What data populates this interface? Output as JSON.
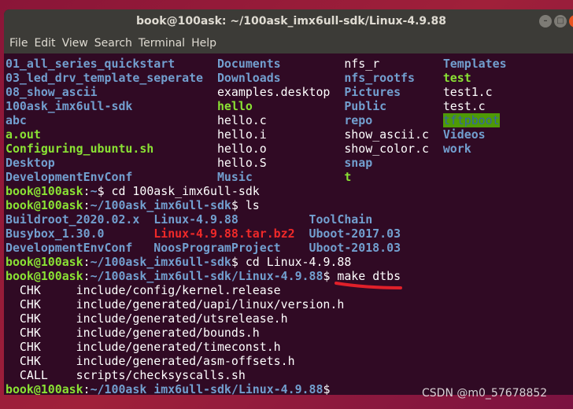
{
  "window": {
    "title": "book@100ask: ~/100ask_imx6ull-sdk/Linux-4.9.88"
  },
  "menu": [
    "File",
    "Edit",
    "View",
    "Search",
    "Terminal",
    "Help"
  ],
  "watermark": "CSDN @m0_57678852",
  "colors": {
    "background": "#300a24",
    "directory": "#729fcf",
    "executable": "#8ae234",
    "archive": "#ef2929",
    "annotation": "#e0202a"
  },
  "lines": [
    [
      {
        "t": "01_all_series_quickstart      ",
        "c": "dir"
      },
      {
        "t": "Documents         ",
        "c": "dir"
      },
      {
        "t": "nfs_r         ",
        "c": "plain"
      },
      {
        "t": "Templates",
        "c": "dir"
      }
    ],
    [
      {
        "t": "03_led_drv_template_seperate  ",
        "c": "dir"
      },
      {
        "t": "Downloads         ",
        "c": "dir"
      },
      {
        "t": "nfs_rootfs    ",
        "c": "dir"
      },
      {
        "t": "test",
        "c": "exe"
      }
    ],
    [
      {
        "t": "08_show_ascii                 ",
        "c": "dir"
      },
      {
        "t": "examples.desktop  ",
        "c": "plain"
      },
      {
        "t": "Pictures      ",
        "c": "dir"
      },
      {
        "t": "test1.c",
        "c": "plain"
      }
    ],
    [
      {
        "t": "100ask_imx6ull-sdk            ",
        "c": "dir"
      },
      {
        "t": "hello             ",
        "c": "exe"
      },
      {
        "t": "Public        ",
        "c": "dir"
      },
      {
        "t": "test.c",
        "c": "plain"
      }
    ],
    [
      {
        "t": "abc                           ",
        "c": "dir"
      },
      {
        "t": "hello.c           ",
        "c": "plain"
      },
      {
        "t": "repo          ",
        "c": "dir"
      },
      {
        "t": "tftpboot",
        "c": "hl"
      }
    ],
    [
      {
        "t": "a.out                         ",
        "c": "exe"
      },
      {
        "t": "hello.i           ",
        "c": "plain"
      },
      {
        "t": "show_ascii.c  ",
        "c": "plain"
      },
      {
        "t": "Videos",
        "c": "dir"
      }
    ],
    [
      {
        "t": "Configuring_ubuntu.sh         ",
        "c": "exe"
      },
      {
        "t": "hello.o           ",
        "c": "plain"
      },
      {
        "t": "show_color.c  ",
        "c": "plain"
      },
      {
        "t": "work",
        "c": "dir"
      }
    ],
    [
      {
        "t": "Desktop                       ",
        "c": "dir"
      },
      {
        "t": "hello.S           ",
        "c": "plain"
      },
      {
        "t": "snap",
        "c": "dir"
      }
    ],
    [
      {
        "t": "DevelopmentEnvConf            ",
        "c": "dir"
      },
      {
        "t": "Music             ",
        "c": "dir"
      },
      {
        "t": "t",
        "c": "exe"
      }
    ],
    [
      {
        "t": "book@100ask",
        "c": "prompt"
      },
      {
        "t": ":",
        "c": "plain"
      },
      {
        "t": "~",
        "c": "path"
      },
      {
        "t": "$ cd 100ask_imx6ull-sdk",
        "c": "plain"
      }
    ],
    [
      {
        "t": "book@100ask",
        "c": "prompt"
      },
      {
        "t": ":",
        "c": "plain"
      },
      {
        "t": "~/100ask_imx6ull-sdk",
        "c": "path"
      },
      {
        "t": "$ ls",
        "c": "plain"
      }
    ],
    [
      {
        "t": "Buildroot_2020.02.x  ",
        "c": "dir"
      },
      {
        "t": "Linux-4.9.88          ",
        "c": "dir"
      },
      {
        "t": "ToolChain",
        "c": "dir"
      }
    ],
    [
      {
        "t": "Busybox_1.30.0       ",
        "c": "dir"
      },
      {
        "t": "Linux-4.9.88.tar.bz2  ",
        "c": "red"
      },
      {
        "t": "Uboot-2017.03",
        "c": "dir"
      }
    ],
    [
      {
        "t": "DevelopmentEnvConf   ",
        "c": "dir"
      },
      {
        "t": "NoosProgramProject    ",
        "c": "dir"
      },
      {
        "t": "Uboot-2018.03",
        "c": "dir"
      }
    ],
    [
      {
        "t": "book@100ask",
        "c": "prompt"
      },
      {
        "t": ":",
        "c": "plain"
      },
      {
        "t": "~/100ask_imx6ull-sdk",
        "c": "path"
      },
      {
        "t": "$ cd Linux-4.9.88",
        "c": "plain"
      }
    ],
    [
      {
        "t": "book@100ask",
        "c": "prompt"
      },
      {
        "t": ":",
        "c": "plain"
      },
      {
        "t": "~/100ask_imx6ull-sdk/Linux-4.9.88",
        "c": "path"
      },
      {
        "t": "$ make dtbs",
        "c": "plain"
      }
    ],
    [
      {
        "t": "  CHK     include/config/kernel.release",
        "c": "plain"
      }
    ],
    [
      {
        "t": "  CHK     include/generated/uapi/linux/version.h",
        "c": "plain"
      }
    ],
    [
      {
        "t": "  CHK     include/generated/utsrelease.h",
        "c": "plain"
      }
    ],
    [
      {
        "t": "  CHK     include/generated/bounds.h",
        "c": "plain"
      }
    ],
    [
      {
        "t": "  CHK     include/generated/timeconst.h",
        "c": "plain"
      }
    ],
    [
      {
        "t": "  CHK     include/generated/asm-offsets.h",
        "c": "plain"
      }
    ],
    [
      {
        "t": "  CALL    scripts/checksyscalls.sh",
        "c": "plain"
      }
    ],
    [
      {
        "t": "book@100ask",
        "c": "prompt"
      },
      {
        "t": ":",
        "c": "plain"
      },
      {
        "t": "~/100ask_imx6ull-sdk/Linux-4.9.88",
        "c": "path"
      },
      {
        "t": "$",
        "c": "plain"
      }
    ]
  ]
}
